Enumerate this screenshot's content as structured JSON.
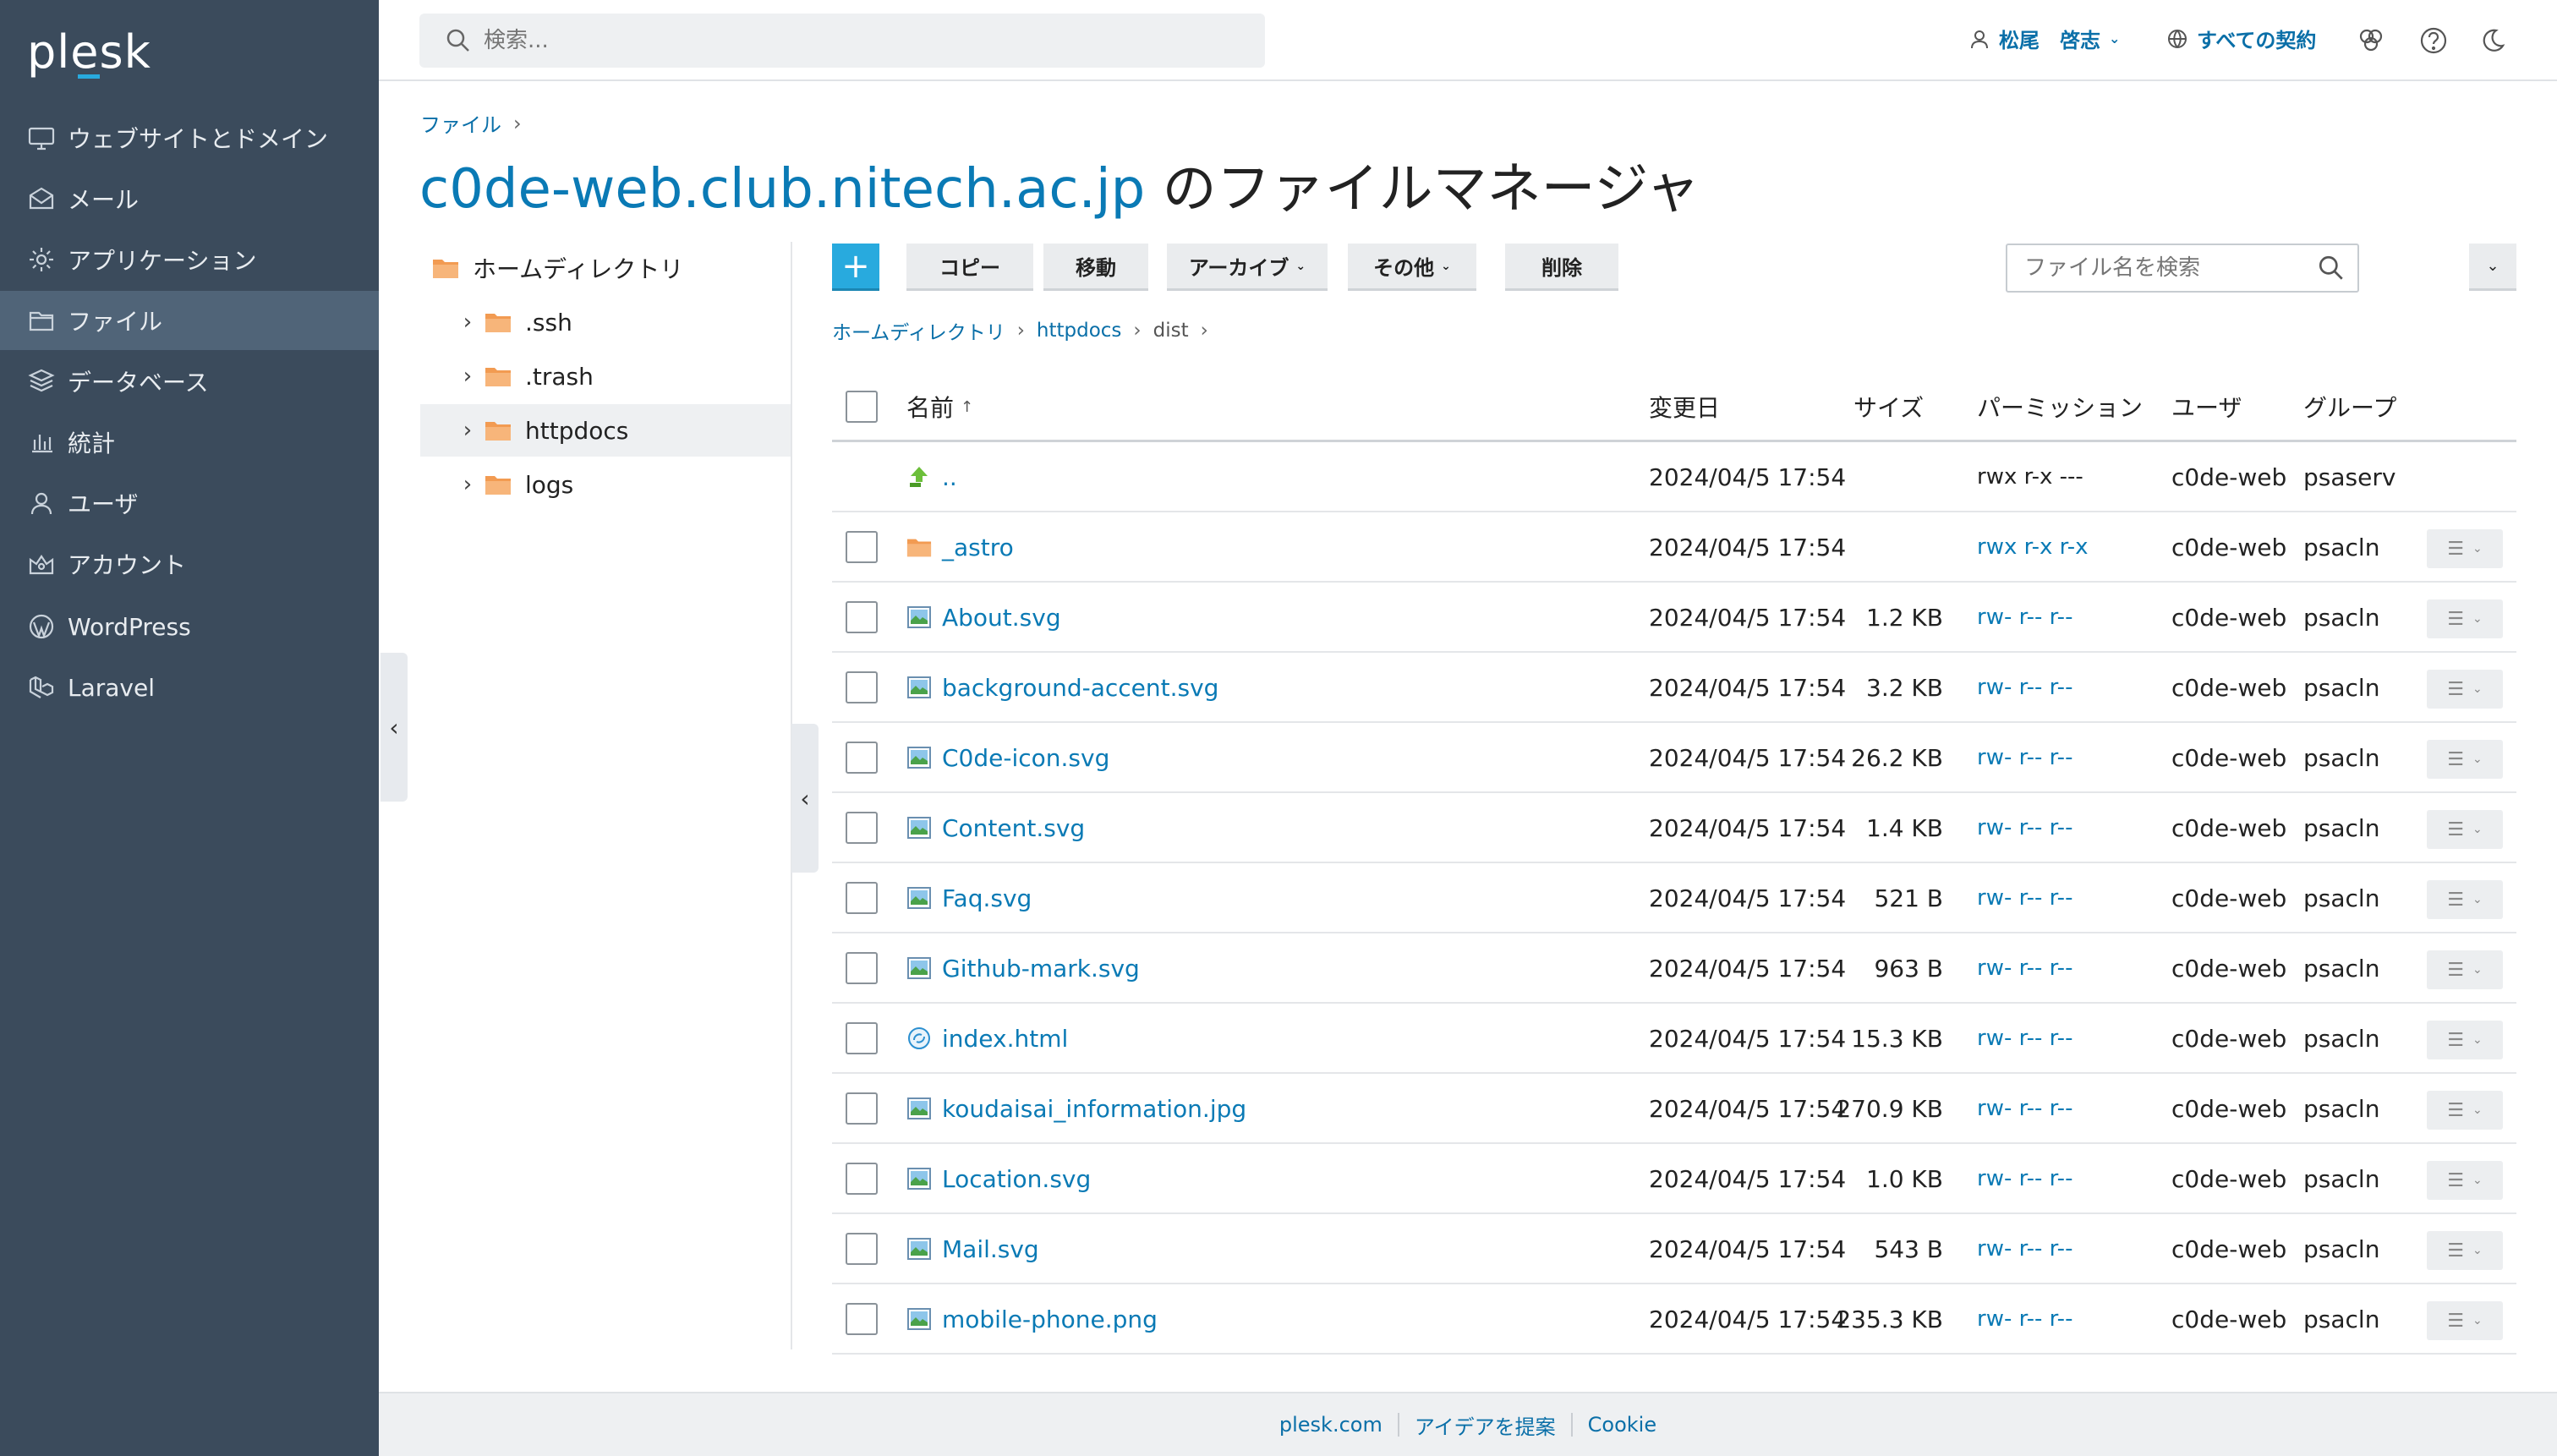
{
  "app": {
    "logo": "plesk"
  },
  "sidebar": {
    "items": [
      {
        "label": "ウェブサイトとドメイン",
        "icon": "monitor-icon"
      },
      {
        "label": "メール",
        "icon": "mail-icon"
      },
      {
        "label": "アプリケーション",
        "icon": "gear-icon"
      },
      {
        "label": "ファイル",
        "icon": "file-manager-icon",
        "active": true
      },
      {
        "label": "データベース",
        "icon": "database-icon"
      },
      {
        "label": "統計",
        "icon": "stats-icon"
      },
      {
        "label": "ユーザ",
        "icon": "user-icon"
      },
      {
        "label": "アカウント",
        "icon": "account-icon"
      },
      {
        "label": "WordPress",
        "icon": "wordpress-icon"
      },
      {
        "label": "Laravel",
        "icon": "laravel-icon"
      }
    ]
  },
  "header": {
    "search_placeholder": "検索...",
    "user_name": "松尾　啓志",
    "subscriptions": "すべての契約"
  },
  "breadcrumb_top": {
    "label": "ファイル"
  },
  "title": {
    "host": "c0de-web.club.nitech.ac.jp",
    "suffix": " のファイルマネージャ"
  },
  "tree": {
    "root": "ホームディレクトリ",
    "children": [
      ".ssh",
      ".trash",
      "httpdocs",
      "logs"
    ],
    "selected": "httpdocs"
  },
  "toolbar": {
    "add": "+",
    "copy": "コピー",
    "move": "移動",
    "archive": "アーカイブ",
    "other": "その他",
    "delete": "削除",
    "search_placeholder": "ファイル名を検索"
  },
  "path": {
    "home": "ホームディレクトリ",
    "httpdocs": "httpdocs",
    "current": "dist"
  },
  "table": {
    "headers": {
      "name": "名前",
      "sort_indicator": "↑",
      "modified": "変更日",
      "size": "サイズ",
      "permissions": "パーミッション",
      "user": "ユーザ",
      "group": "グループ"
    },
    "rows": [
      {
        "name": "..",
        "type": "up",
        "modified": "2024/04/5 17:54",
        "size": "",
        "perm": "rwx r-x ---",
        "perm_link": false,
        "user": "c0de-web",
        "group": "psaserv"
      },
      {
        "name": "_astro",
        "type": "folder",
        "modified": "2024/04/5 17:54",
        "size": "",
        "perm": "rwx r-x r-x",
        "perm_link": true,
        "user": "c0de-web",
        "group": "psacln"
      },
      {
        "name": "About.svg",
        "type": "image",
        "modified": "2024/04/5 17:54",
        "size": "1.2 KB",
        "perm": "rw- r-- r--",
        "perm_link": true,
        "user": "c0de-web",
        "group": "psacln"
      },
      {
        "name": "background-accent.svg",
        "type": "image",
        "modified": "2024/04/5 17:54",
        "size": "3.2 KB",
        "perm": "rw- r-- r--",
        "perm_link": true,
        "user": "c0de-web",
        "group": "psacln"
      },
      {
        "name": "C0de-icon.svg",
        "type": "image",
        "modified": "2024/04/5 17:54",
        "size": "26.2 KB",
        "perm": "rw- r-- r--",
        "perm_link": true,
        "user": "c0de-web",
        "group": "psacln"
      },
      {
        "name": "Content.svg",
        "type": "image",
        "modified": "2024/04/5 17:54",
        "size": "1.4 KB",
        "perm": "rw- r-- r--",
        "perm_link": true,
        "user": "c0de-web",
        "group": "psacln"
      },
      {
        "name": "Faq.svg",
        "type": "image",
        "modified": "2024/04/5 17:54",
        "size": "521 B",
        "perm": "rw- r-- r--",
        "perm_link": true,
        "user": "c0de-web",
        "group": "psacln"
      },
      {
        "name": "Github-mark.svg",
        "type": "image",
        "modified": "2024/04/5 17:54",
        "size": "963 B",
        "perm": "rw- r-- r--",
        "perm_link": true,
        "user": "c0de-web",
        "group": "psacln"
      },
      {
        "name": "index.html",
        "type": "html",
        "modified": "2024/04/5 17:54",
        "size": "15.3 KB",
        "perm": "rw- r-- r--",
        "perm_link": true,
        "user": "c0de-web",
        "group": "psacln"
      },
      {
        "name": "koudaisai_information.jpg",
        "type": "image",
        "modified": "2024/04/5 17:54",
        "size": "270.9 KB",
        "perm": "rw- r-- r--",
        "perm_link": true,
        "user": "c0de-web",
        "group": "psacln"
      },
      {
        "name": "Location.svg",
        "type": "image",
        "modified": "2024/04/5 17:54",
        "size": "1.0 KB",
        "perm": "rw- r-- r--",
        "perm_link": true,
        "user": "c0de-web",
        "group": "psacln"
      },
      {
        "name": "Mail.svg",
        "type": "image",
        "modified": "2024/04/5 17:54",
        "size": "543 B",
        "perm": "rw- r-- r--",
        "perm_link": true,
        "user": "c0de-web",
        "group": "psacln"
      },
      {
        "name": "mobile-phone.png",
        "type": "image",
        "modified": "2024/04/5 17:54",
        "size": "235.3 KB",
        "perm": "rw- r-- r--",
        "perm_link": true,
        "user": "c0de-web",
        "group": "psacln"
      }
    ]
  },
  "footer": {
    "links": [
      "plesk.com",
      "アイデアを提案",
      "Cookie"
    ]
  },
  "colors": {
    "sidebar_bg": "#3b4b5c",
    "sidebar_active": "#506478",
    "accent": "#28aade",
    "link": "#0a7ab5"
  }
}
